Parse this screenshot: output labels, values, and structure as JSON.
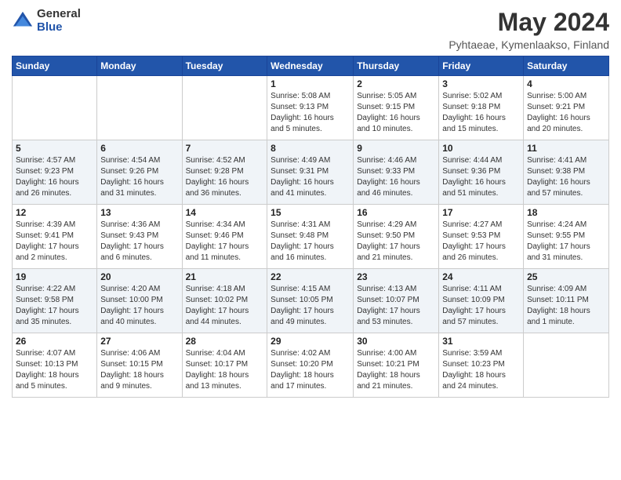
{
  "logo": {
    "general": "General",
    "blue": "Blue"
  },
  "title": "May 2024",
  "subtitle": "Pyhtaeae, Kymenlaakso, Finland",
  "days_of_week": [
    "Sunday",
    "Monday",
    "Tuesday",
    "Wednesday",
    "Thursday",
    "Friday",
    "Saturday"
  ],
  "weeks": [
    [
      {
        "day": "",
        "info": ""
      },
      {
        "day": "",
        "info": ""
      },
      {
        "day": "",
        "info": ""
      },
      {
        "day": "1",
        "info": "Sunrise: 5:08 AM\nSunset: 9:13 PM\nDaylight: 16 hours\nand 5 minutes."
      },
      {
        "day": "2",
        "info": "Sunrise: 5:05 AM\nSunset: 9:15 PM\nDaylight: 16 hours\nand 10 minutes."
      },
      {
        "day": "3",
        "info": "Sunrise: 5:02 AM\nSunset: 9:18 PM\nDaylight: 16 hours\nand 15 minutes."
      },
      {
        "day": "4",
        "info": "Sunrise: 5:00 AM\nSunset: 9:21 PM\nDaylight: 16 hours\nand 20 minutes."
      }
    ],
    [
      {
        "day": "5",
        "info": "Sunrise: 4:57 AM\nSunset: 9:23 PM\nDaylight: 16 hours\nand 26 minutes."
      },
      {
        "day": "6",
        "info": "Sunrise: 4:54 AM\nSunset: 9:26 PM\nDaylight: 16 hours\nand 31 minutes."
      },
      {
        "day": "7",
        "info": "Sunrise: 4:52 AM\nSunset: 9:28 PM\nDaylight: 16 hours\nand 36 minutes."
      },
      {
        "day": "8",
        "info": "Sunrise: 4:49 AM\nSunset: 9:31 PM\nDaylight: 16 hours\nand 41 minutes."
      },
      {
        "day": "9",
        "info": "Sunrise: 4:46 AM\nSunset: 9:33 PM\nDaylight: 16 hours\nand 46 minutes."
      },
      {
        "day": "10",
        "info": "Sunrise: 4:44 AM\nSunset: 9:36 PM\nDaylight: 16 hours\nand 51 minutes."
      },
      {
        "day": "11",
        "info": "Sunrise: 4:41 AM\nSunset: 9:38 PM\nDaylight: 16 hours\nand 57 minutes."
      }
    ],
    [
      {
        "day": "12",
        "info": "Sunrise: 4:39 AM\nSunset: 9:41 PM\nDaylight: 17 hours\nand 2 minutes."
      },
      {
        "day": "13",
        "info": "Sunrise: 4:36 AM\nSunset: 9:43 PM\nDaylight: 17 hours\nand 6 minutes."
      },
      {
        "day": "14",
        "info": "Sunrise: 4:34 AM\nSunset: 9:46 PM\nDaylight: 17 hours\nand 11 minutes."
      },
      {
        "day": "15",
        "info": "Sunrise: 4:31 AM\nSunset: 9:48 PM\nDaylight: 17 hours\nand 16 minutes."
      },
      {
        "day": "16",
        "info": "Sunrise: 4:29 AM\nSunset: 9:50 PM\nDaylight: 17 hours\nand 21 minutes."
      },
      {
        "day": "17",
        "info": "Sunrise: 4:27 AM\nSunset: 9:53 PM\nDaylight: 17 hours\nand 26 minutes."
      },
      {
        "day": "18",
        "info": "Sunrise: 4:24 AM\nSunset: 9:55 PM\nDaylight: 17 hours\nand 31 minutes."
      }
    ],
    [
      {
        "day": "19",
        "info": "Sunrise: 4:22 AM\nSunset: 9:58 PM\nDaylight: 17 hours\nand 35 minutes."
      },
      {
        "day": "20",
        "info": "Sunrise: 4:20 AM\nSunset: 10:00 PM\nDaylight: 17 hours\nand 40 minutes."
      },
      {
        "day": "21",
        "info": "Sunrise: 4:18 AM\nSunset: 10:02 PM\nDaylight: 17 hours\nand 44 minutes."
      },
      {
        "day": "22",
        "info": "Sunrise: 4:15 AM\nSunset: 10:05 PM\nDaylight: 17 hours\nand 49 minutes."
      },
      {
        "day": "23",
        "info": "Sunrise: 4:13 AM\nSunset: 10:07 PM\nDaylight: 17 hours\nand 53 minutes."
      },
      {
        "day": "24",
        "info": "Sunrise: 4:11 AM\nSunset: 10:09 PM\nDaylight: 17 hours\nand 57 minutes."
      },
      {
        "day": "25",
        "info": "Sunrise: 4:09 AM\nSunset: 10:11 PM\nDaylight: 18 hours\nand 1 minute."
      }
    ],
    [
      {
        "day": "26",
        "info": "Sunrise: 4:07 AM\nSunset: 10:13 PM\nDaylight: 18 hours\nand 5 minutes."
      },
      {
        "day": "27",
        "info": "Sunrise: 4:06 AM\nSunset: 10:15 PM\nDaylight: 18 hours\nand 9 minutes."
      },
      {
        "day": "28",
        "info": "Sunrise: 4:04 AM\nSunset: 10:17 PM\nDaylight: 18 hours\nand 13 minutes."
      },
      {
        "day": "29",
        "info": "Sunrise: 4:02 AM\nSunset: 10:20 PM\nDaylight: 18 hours\nand 17 minutes."
      },
      {
        "day": "30",
        "info": "Sunrise: 4:00 AM\nSunset: 10:21 PM\nDaylight: 18 hours\nand 21 minutes."
      },
      {
        "day": "31",
        "info": "Sunrise: 3:59 AM\nSunset: 10:23 PM\nDaylight: 18 hours\nand 24 minutes."
      },
      {
        "day": "",
        "info": ""
      }
    ]
  ]
}
